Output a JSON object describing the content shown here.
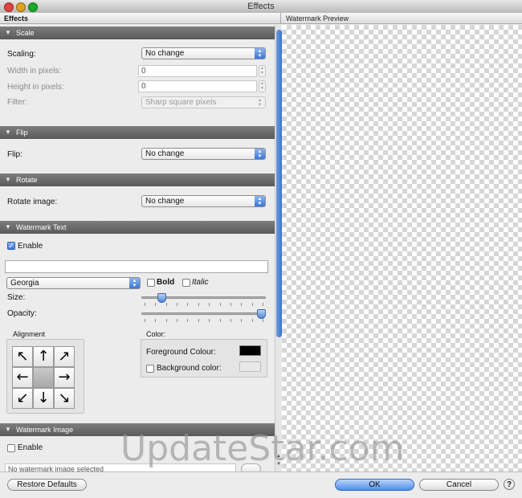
{
  "window": {
    "title": "Effects",
    "traffic_lights": [
      "#e0443e",
      "#dea123",
      "#1aab29"
    ]
  },
  "headers": {
    "effects": "Effects",
    "preview": "Watermark Preview"
  },
  "scale": {
    "title": "Scale",
    "scaling_label": "Scaling:",
    "scaling_value": "No change",
    "width_label": "Width in pixels:",
    "width_value": "0",
    "height_label": "Height in pixels:",
    "height_value": "0",
    "filter_label": "Filter:",
    "filter_value": "Sharp square pixels"
  },
  "flip": {
    "title": "Flip",
    "flip_label": "Flip:",
    "flip_value": "No change"
  },
  "rotate": {
    "title": "Rotate",
    "rotate_label": "Rotate image:",
    "rotate_value": "No change"
  },
  "watermark_text": {
    "title": "Watermark Text",
    "enable_label": "Enable",
    "enabled": true,
    "text_value": "",
    "font_value": "Georgia",
    "bold_label": "Bold",
    "italic_label": "Italic",
    "size_label": "Size:",
    "size_level": 0.14,
    "opacity_label": "Opacity:",
    "opacity_level": 1.0,
    "alignment_label": "Alignment",
    "alignment_arrows": [
      "↖",
      "↑",
      "↗",
      "←",
      "",
      "→",
      "↙",
      "↓",
      "↘"
    ],
    "color_label": "Color:",
    "foreground_label": "Foreground Colour:",
    "foreground_color": "#000000",
    "background_label": "Background color:"
  },
  "watermark_image": {
    "title": "Watermark Image",
    "enable_label": "Enable",
    "status_text": "No watermark image selected"
  },
  "buttons": {
    "restore": "Restore Defaults",
    "ok": "OK",
    "cancel": "Cancel",
    "help": "?"
  },
  "site_watermark": "UpdateStar.com",
  "accent_color": "#3a76d8"
}
